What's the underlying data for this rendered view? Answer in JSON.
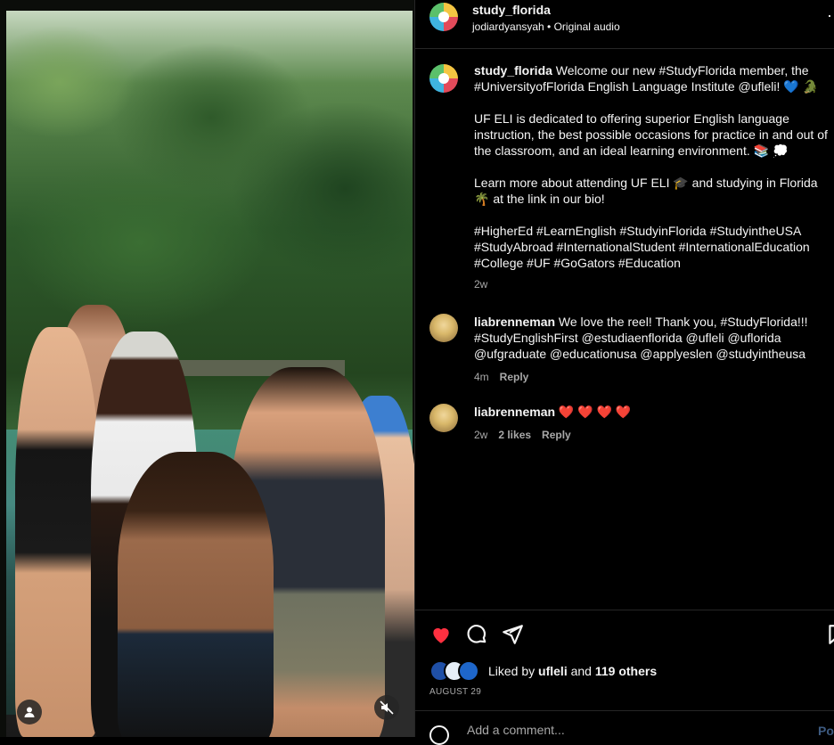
{
  "header": {
    "username": "study_florida",
    "subtitle": "jodiardyansyah • Original audio",
    "more_icon": "more-horizontal-icon"
  },
  "caption": {
    "username": "study_florida",
    "paragraphs": [
      "Welcome our new #StudyFlorida member, the #UniversityofFlorida English Language Institute @ufleli! 💙 🐊",
      "UF ELI is dedicated to offering superior English language instruction, the best possible occasions for practice in and out of the classroom, and an ideal learning environment. 📚 💭",
      "Learn more about attending UF ELI 🎓 and studying in Florida 🌴 at the link in our bio!",
      "#HigherEd #LearnEnglish #StudyinFlorida #StudyintheUSA #StudyAbroad #InternationalStudent #InternationalEducation #College #UF #GoGators #Education"
    ],
    "time": "2w"
  },
  "comments": [
    {
      "username": "liabrenneman",
      "text": "We love the reel! Thank you, #StudyFlorida!!! #StudyEnglishFirst @estudiaenflorida @ufleli @uflorida @ufgraduate @educationusa @applyeslen @studyintheusa",
      "time": "4m",
      "likes": "",
      "reply": "Reply"
    },
    {
      "username": "liabrenneman",
      "text": "❤️ ❤️ ❤️ ❤️",
      "time": "2w",
      "likes": "2 likes",
      "reply": "Reply"
    }
  ],
  "actions": {
    "liked_prefix": "Liked by",
    "liked_user": "ufleli",
    "liked_and": "and",
    "liked_others": "119 others",
    "date": "AUGUST 29"
  },
  "add_comment": {
    "placeholder": "Add a comment...",
    "post_label": "Post"
  },
  "colors": {
    "like": "#ff3040",
    "secondary_text": "#a8a8a8",
    "divider": "#262626"
  }
}
